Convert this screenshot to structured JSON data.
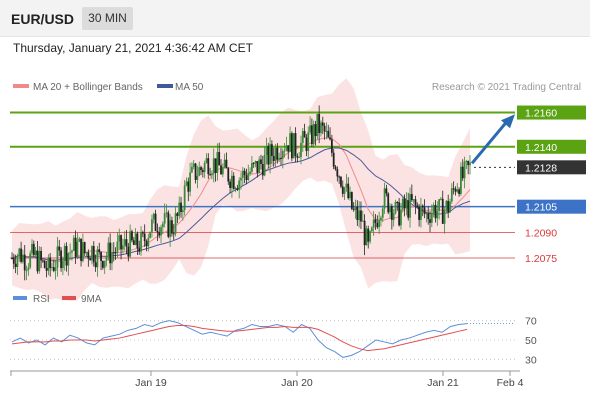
{
  "header": {
    "symbol": "EUR/USD",
    "timeframe": "30 MIN"
  },
  "timestamp": "Thursday, January 21, 2021 4:36:42 AM CET",
  "legend": {
    "bollinger": "MA 20 + Bollinger Bands",
    "ma50": "MA 50",
    "copyright": "Research © 2021 Trading Central"
  },
  "rsi_legend": {
    "rsi": "RSI",
    "ma9": "9MA"
  },
  "colors": {
    "green": "#5ba313",
    "blue": "#3d73c7",
    "red": "#d93a3a",
    "candle_up": "#3a8a3a",
    "candle_down": "#222222",
    "band": "#fbdada",
    "ma20": "#f08a8a",
    "ma50": "#4a5a9a",
    "rsi": "#5b8fdb",
    "rsi_ma": "#e05050",
    "arrow": "#2a6ab0",
    "current": "#333333"
  },
  "chart_data": [
    {
      "type": "candlestick",
      "ylim": [
        1.2061,
        1.2172
      ],
      "x_ticks": [
        "Jan 19",
        "Jan 20",
        "Jan 21",
        "Feb 4"
      ],
      "levels": [
        {
          "label": "1.2160",
          "value": 1.216,
          "kind": "resistance"
        },
        {
          "label": "1.2140",
          "value": 1.214,
          "kind": "resistance"
        },
        {
          "label": "1.2128",
          "value": 1.2128,
          "kind": "current"
        },
        {
          "label": "1.2105",
          "value": 1.2105,
          "kind": "pivot"
        },
        {
          "label": "1.2090",
          "value": 1.209,
          "kind": "support"
        },
        {
          "label": "1.2075",
          "value": 1.2075,
          "kind": "support"
        }
      ],
      "close_path": [
        1.2075,
        1.2078,
        1.2074,
        1.2076,
        1.2072,
        1.2068,
        1.2073,
        1.2078,
        1.2079,
        1.2082,
        1.2078,
        1.208,
        1.2075,
        1.2077,
        1.2079,
        1.2081,
        1.2083,
        1.2082,
        1.2084,
        1.2093,
        1.2096,
        1.2095,
        1.2093,
        1.21,
        1.2118,
        1.2124,
        1.2127,
        1.2132,
        1.213,
        1.2126,
        1.2123,
        1.2121,
        1.2124,
        1.2126,
        1.2129,
        1.2133,
        1.2137,
        1.2141,
        1.2143,
        1.2139,
        1.2142,
        1.2145,
        1.2152,
        1.2148,
        1.2137,
        1.2125,
        1.2113,
        1.2101,
        1.2098,
        1.208,
        1.2096,
        1.211,
        1.2107,
        1.21,
        1.2104,
        1.2106,
        1.2103,
        1.21,
        1.2104,
        1.2102,
        1.2105,
        1.2118,
        1.2122,
        1.2128
      ]
    },
    {
      "type": "line",
      "title": "RSI",
      "yticks": [
        70,
        50,
        30
      ],
      "ylim": [
        20,
        80
      ],
      "series": [
        {
          "name": "RSI",
          "values": [
            48,
            52,
            47,
            50,
            45,
            52,
            48,
            55,
            52,
            47,
            45,
            52,
            54,
            56,
            60,
            62,
            66,
            64,
            68,
            70,
            68,
            64,
            60,
            56,
            58,
            56,
            54,
            60,
            62,
            66,
            64,
            64,
            66,
            64,
            58,
            66,
            62,
            50,
            42,
            38,
            32,
            34,
            38,
            44,
            50,
            48,
            46,
            50,
            52,
            55,
            58,
            60,
            58,
            64,
            66,
            67
          ]
        },
        {
          "name": "9MA",
          "values": [
            46,
            47,
            48,
            48,
            48,
            49,
            49,
            50,
            50,
            50,
            49,
            50,
            51,
            52,
            54,
            56,
            58,
            60,
            62,
            64,
            65,
            65,
            64,
            62,
            61,
            60,
            59,
            59,
            60,
            61,
            62,
            63,
            63,
            64,
            63,
            63,
            63,
            61,
            57,
            53,
            48,
            44,
            41,
            39,
            40,
            41,
            43,
            45,
            47,
            49,
            51,
            53,
            55,
            57,
            59,
            61
          ]
        }
      ]
    }
  ]
}
